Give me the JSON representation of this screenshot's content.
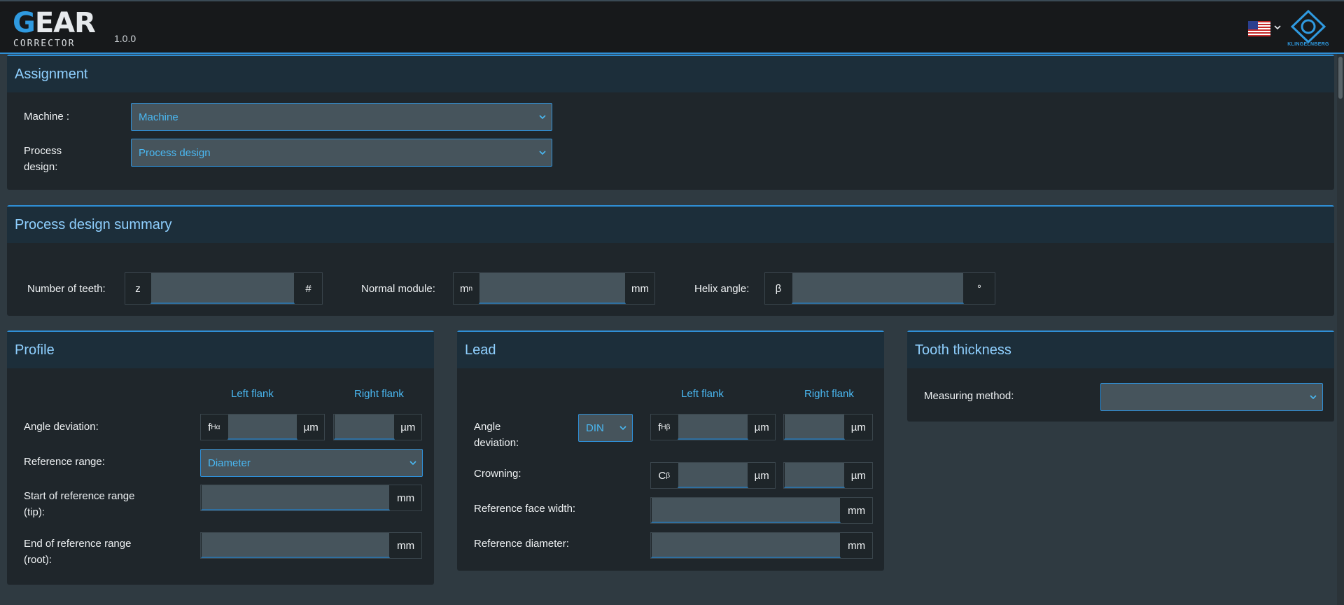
{
  "header": {
    "logo_main": "GEAR",
    "logo_sub": "CORRECTOR",
    "version": "1.0.0",
    "brand_name": "KLINGELNBERG",
    "language_icon": "us-flag-icon"
  },
  "assignment": {
    "title": "Assignment",
    "machine_label": "Machine :",
    "machine_value": "Machine",
    "process_label_1": "Process",
    "process_label_2": "design:",
    "process_value": "Process design"
  },
  "summary": {
    "title": "Process design summary",
    "teeth_label": "Number of teeth:",
    "teeth_prefix": "z",
    "teeth_suffix": "#",
    "module_label": "Normal module:",
    "module_prefix_base": "m",
    "module_prefix_sub": "n",
    "module_suffix": "mm",
    "helix_label": "Helix angle:",
    "helix_prefix": "β",
    "helix_suffix": "°"
  },
  "profile": {
    "title": "Profile",
    "left_flank": "Left flank",
    "right_flank": "Right flank",
    "angle_label": "Angle deviation:",
    "angle_prefix_base": "f",
    "angle_prefix_sub": "Hα",
    "unit_um": "µm",
    "ref_range_label": "Reference range:",
    "ref_range_value": "Diameter",
    "start_label_1": "Start of reference range",
    "start_label_2": "(tip):",
    "end_label_1": "End of reference range",
    "end_label_2": "(root):",
    "unit_mm": "mm"
  },
  "lead": {
    "title": "Lead",
    "left_flank": "Left flank",
    "right_flank": "Right flank",
    "angle_label_1": "Angle",
    "angle_label_2": "deviation:",
    "standard_value": "DIN",
    "angle_prefix_base": "f",
    "angle_prefix_sub": "Hβ",
    "unit_um": "µm",
    "crowning_label": "Crowning:",
    "crowning_prefix_base": "C",
    "crowning_prefix_sub": "β",
    "face_width_label": "Reference face width:",
    "ref_diameter_label": "Reference diameter:",
    "unit_mm": "mm"
  },
  "tooth": {
    "title": "Tooth thickness",
    "method_label": "Measuring method:",
    "method_value": ""
  },
  "colors": {
    "accent": "#2f8fd6",
    "text_accent": "#4ab8f2",
    "panel_bg": "#1f262b",
    "page_bg": "#2f3a41"
  }
}
